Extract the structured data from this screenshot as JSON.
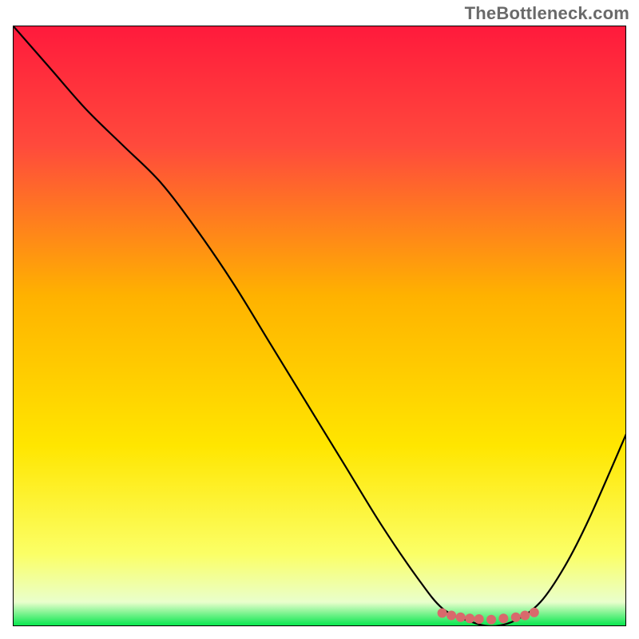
{
  "watermark": "TheBottleneck.com",
  "chart_data": {
    "type": "line",
    "title": "",
    "xlabel": "",
    "ylabel": "",
    "xlim": [
      0,
      100
    ],
    "ylim": [
      0,
      100
    ],
    "grid": false,
    "gradient_stops": [
      {
        "offset": 0,
        "color": "#ff1a3c"
      },
      {
        "offset": 20,
        "color": "#ff4a3c"
      },
      {
        "offset": 45,
        "color": "#ffb200"
      },
      {
        "offset": 70,
        "color": "#ffe600"
      },
      {
        "offset": 88,
        "color": "#fbff66"
      },
      {
        "offset": 96,
        "color": "#e9ffcc"
      },
      {
        "offset": 100,
        "color": "#00e64a"
      }
    ],
    "series": [
      {
        "name": "bottleneck-curve",
        "color": "#000000",
        "x": [
          0,
          6,
          12,
          18,
          24,
          30,
          36,
          42,
          48,
          54,
          60,
          66,
          70,
          74,
          78,
          82,
          86,
          90,
          94,
          100
        ],
        "y": [
          100,
          93,
          86,
          80,
          74,
          66,
          57,
          47,
          37,
          27,
          17,
          8,
          3,
          1,
          0,
          1,
          4,
          10,
          18,
          32
        ]
      }
    ],
    "marker_cluster": {
      "name": "optimum-markers",
      "color": "#d9696c",
      "points": [
        {
          "x": 70,
          "y": 2.2
        },
        {
          "x": 71.5,
          "y": 1.8
        },
        {
          "x": 73,
          "y": 1.5
        },
        {
          "x": 74.5,
          "y": 1.3
        },
        {
          "x": 76,
          "y": 1.2
        },
        {
          "x": 78,
          "y": 1.1
        },
        {
          "x": 80,
          "y": 1.3
        },
        {
          "x": 82,
          "y": 1.5
        },
        {
          "x": 83.5,
          "y": 1.8
        },
        {
          "x": 85,
          "y": 2.3
        }
      ]
    }
  }
}
